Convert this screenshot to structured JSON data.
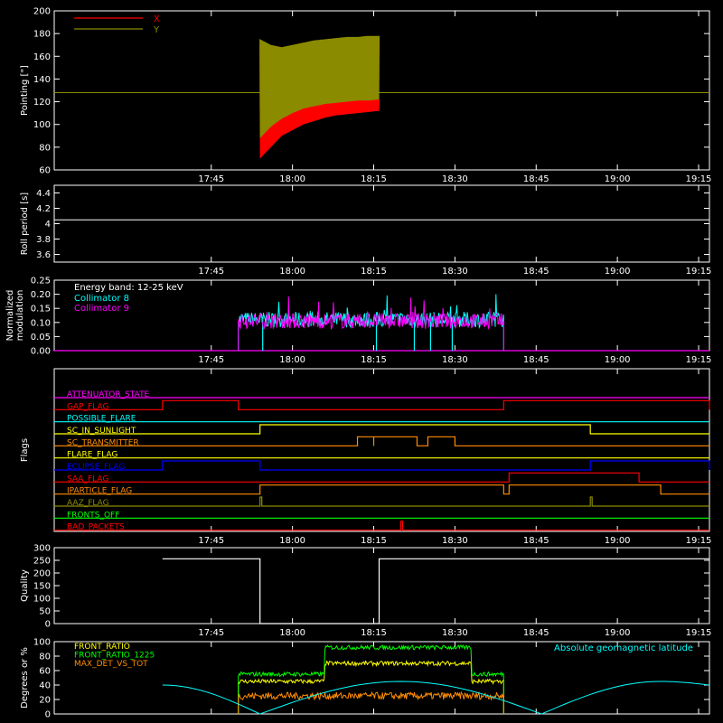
{
  "colors": {
    "background": "#000000",
    "axis": "#ffffff",
    "x_red": "#ff0000",
    "y_olive": "#8b8b00",
    "cyan": "#00ffff",
    "magenta": "#ff00ff",
    "green": "#00ff00",
    "yellow": "#ffff00",
    "orange": "#ff8c00",
    "blue": "#0000ff"
  },
  "time_axis": {
    "tick_labels": [
      "17:45",
      "18:00",
      "18:15",
      "18:30",
      "18:45",
      "19:00",
      "19:15"
    ],
    "tick_minutes": [
      1065,
      1080,
      1095,
      1110,
      1125,
      1140,
      1155
    ],
    "range_minutes": [
      1036,
      1157
    ]
  },
  "chart_data": [
    {
      "id": "pointing",
      "type": "line",
      "ylabel": "Pointing [\"]",
      "ylim": [
        60,
        200
      ],
      "yticks": [
        60,
        80,
        100,
        120,
        140,
        160,
        180,
        200
      ],
      "legend": [
        "X",
        "Y"
      ],
      "legend_placement": "top-left",
      "series": [
        {
          "name": "X",
          "color_key": "x_red",
          "t_start": "17:54",
          "t_end": "18:16",
          "envelope_min": [
            70,
            80,
            90,
            95,
            100,
            103,
            106,
            108,
            109,
            110,
            111,
            112
          ],
          "envelope_max": [
            170,
            155,
            140,
            135,
            130,
            128,
            127,
            126,
            125,
            124,
            123,
            122
          ]
        },
        {
          "name": "Y",
          "color_key": "y_olive",
          "t_start": "17:54",
          "t_end": "18:16",
          "envelope_min": [
            88,
            98,
            105,
            110,
            114,
            116,
            118,
            119,
            120,
            121,
            121,
            122
          ],
          "envelope_max": [
            175,
            170,
            168,
            170,
            172,
            174,
            175,
            176,
            177,
            177,
            178,
            178
          ],
          "extra_constant": 128
        }
      ]
    },
    {
      "id": "roll_period",
      "type": "line",
      "ylabel": "Roll period [s]",
      "ylim": [
        3.5,
        4.5
      ],
      "yticks": [
        3.6,
        3.8,
        4.0,
        4.2,
        4.4
      ],
      "series": [
        {
          "color_key": "axis",
          "constant": 4.05
        }
      ]
    },
    {
      "id": "modulation",
      "type": "line",
      "ylabel": "Normalized\nmodulation",
      "ylim": [
        0,
        0.25
      ],
      "yticks": [
        0.0,
        0.05,
        0.1,
        0.15,
        0.2,
        0.25
      ],
      "ytick_labels": [
        "0.00",
        "0.05",
        "0.10",
        "0.15",
        "0.20",
        "0.25"
      ],
      "annotation": "Energy band: 12-25 keV",
      "series": [
        {
          "name": "Collimator 8",
          "color_key": "cyan",
          "t_start": "17:50",
          "t_end": "18:39",
          "mean": 0.11,
          "dips_to_zero": [
            "17:54",
            "18:15",
            "18:22",
            "18:25",
            "18:29"
          ]
        },
        {
          "name": "Collimator 9",
          "color_key": "magenta",
          "t_start": "17:50",
          "t_end": "18:39",
          "mean": 0.105
        }
      ]
    },
    {
      "id": "flags",
      "type": "line",
      "ylabel": "Flags",
      "flags": [
        {
          "name": "ATTENUATOR_STATE",
          "color_key": "magenta",
          "on": []
        },
        {
          "name": "GAP_FLAG",
          "color_key": "x_red",
          "on": [
            [
              "17:36",
              "17:50"
            ],
            [
              "18:39",
              "19:17"
            ]
          ]
        },
        {
          "name": "POSSIBLE_FLARE",
          "color_key": "cyan",
          "on": []
        },
        {
          "name": "SC_IN_SUNLIGHT",
          "color_key": "yellow",
          "on": [
            [
              "17:54",
              "18:55"
            ]
          ]
        },
        {
          "name": "SC_TRANSMITTER",
          "color_key": "orange",
          "on": [
            [
              "18:12",
              "18:15"
            ],
            [
              "18:15",
              "18:23"
            ],
            [
              "18:25",
              "18:30"
            ]
          ]
        },
        {
          "name": "FLARE_FLAG",
          "color_key": "yellow",
          "on": []
        },
        {
          "name": "ECLIPSE_FLAG",
          "color_key": "blue",
          "on": [
            [
              "17:36",
              "17:54"
            ],
            [
              "18:55",
              "19:17"
            ]
          ]
        },
        {
          "name": "SAA_FLAG",
          "color_key": "x_red",
          "on": [
            [
              "18:40",
              "19:04"
            ]
          ]
        },
        {
          "name": "IPARTICLE_FLAG",
          "color_key": "orange",
          "on": [
            [
              "17:54",
              "18:39"
            ],
            [
              "18:40",
              "19:08"
            ]
          ]
        },
        {
          "name": "AAZ_FLAG",
          "color_key": "y_olive",
          "on": [
            [
              "17:54",
              "17:54"
            ],
            [
              "18:55",
              "18:55"
            ]
          ]
        },
        {
          "name": "FRONTS_OFF",
          "color_key": "green",
          "on": []
        },
        {
          "name": "BAD_PACKETS",
          "color_key": "x_red",
          "on": [
            [
              "18:20",
              "18:20"
            ]
          ]
        }
      ]
    },
    {
      "id": "quality",
      "type": "line",
      "ylabel": "Quality",
      "ylim": [
        0,
        300
      ],
      "yticks": [
        0,
        50,
        100,
        150,
        200,
        250,
        300
      ],
      "series": [
        {
          "color_key": "axis",
          "segments": [
            [
              "17:36",
              "17:54",
              256
            ],
            [
              "17:54",
              "18:16",
              0
            ],
            [
              "18:16",
              "19:17",
              256
            ]
          ]
        }
      ]
    },
    {
      "id": "ratios",
      "type": "line",
      "ylabel": "Degrees or %",
      "ylim": [
        0,
        100
      ],
      "yticks": [
        0,
        20,
        40,
        60,
        80,
        100
      ],
      "annotation": "Absolute geomagnetic latitude",
      "series": [
        {
          "name": "FRONT_RATIO",
          "color_key": "yellow",
          "t_start": "17:50",
          "t_end": "18:39",
          "levels": [
            [
              "17:50",
              "18:06",
              45
            ],
            [
              "18:06",
              "18:33",
              70
            ],
            [
              "18:33",
              "18:39",
              45
            ]
          ]
        },
        {
          "name": "FRONT_RATIO_1225",
          "color_key": "green",
          "t_start": "17:50",
          "t_end": "18:39",
          "levels": [
            [
              "17:50",
              "18:06",
              55
            ],
            [
              "18:06",
              "18:33",
              92
            ],
            [
              "18:33",
              "18:39",
              55
            ]
          ]
        },
        {
          "name": "MAX_DET_VS_TOT",
          "color_key": "orange",
          "t_start": "17:50",
          "t_end": "18:39",
          "mean": 25
        },
        {
          "name": "Absolute geomagnetic latitude",
          "color_key": "cyan",
          "points": [
            [
              "17:36",
              40
            ],
            [
              "17:54",
              0
            ],
            [
              "18:20",
              45
            ],
            [
              "18:46",
              0
            ],
            [
              "19:08",
              45
            ],
            [
              "19:17",
              40
            ]
          ]
        }
      ]
    }
  ]
}
